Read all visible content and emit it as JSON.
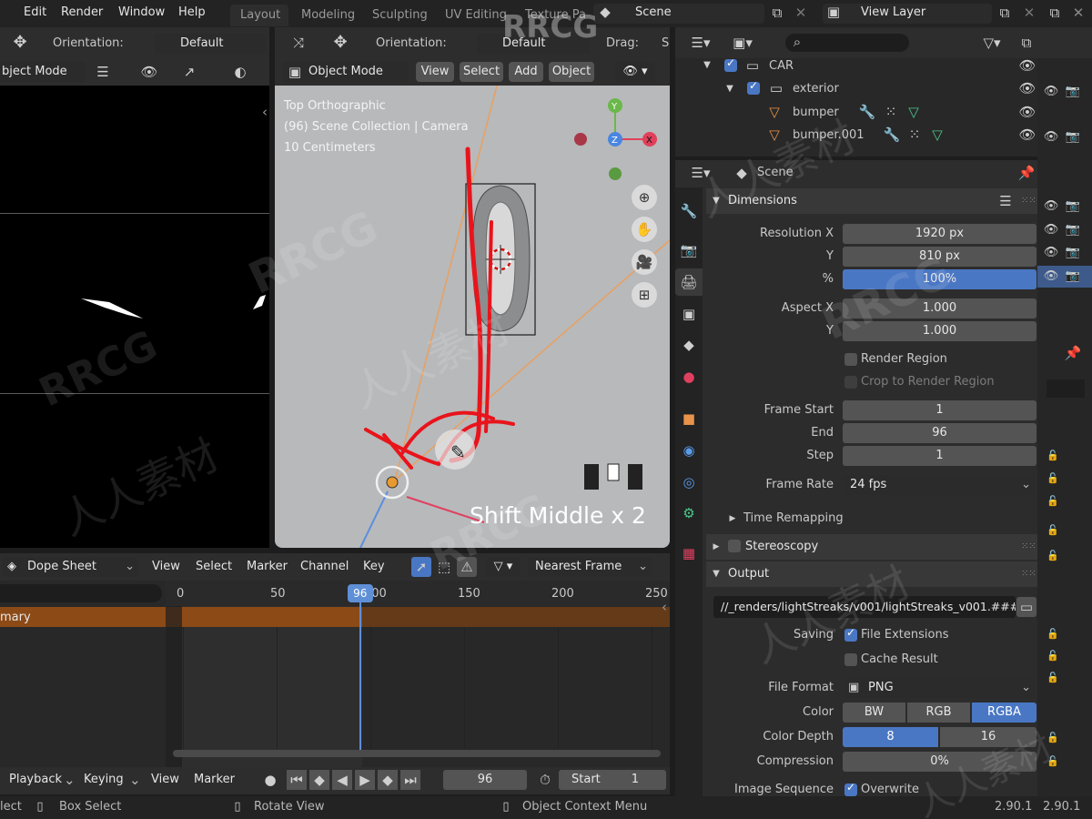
{
  "topbar": {
    "menus": [
      "Edit",
      "Render",
      "Window",
      "Help"
    ],
    "workspace_tabs": [
      "Layout",
      "Modeling",
      "Sculpting",
      "UV Editing",
      "Texture Pa"
    ],
    "scene_name": "Scene",
    "view_layer": "View Layer"
  },
  "left_viewport": {
    "orientation_label": "Orientation:",
    "orientation_value": "Default",
    "mode": "bject Mode"
  },
  "viewport": {
    "orientation_label": "Orientation:",
    "orientation_value": "Default",
    "drag_label": "Drag:",
    "drag_value": "S",
    "mode": "Object Mode",
    "menus": [
      "View",
      "Select",
      "Add",
      "Object"
    ],
    "overlay": [
      "Top Orthographic",
      "(96) Scene Collection | Camera",
      "10 Centimeters"
    ],
    "gizmo": {
      "x": "X",
      "y": "Y",
      "z": "Z"
    },
    "keystroke": "Shift Middle x 2"
  },
  "outliner": {
    "rows": [
      {
        "label": "CAR",
        "checked": true
      },
      {
        "label": "exterior",
        "checked": true
      },
      {
        "label": "bumper"
      },
      {
        "label": "bumper.001"
      }
    ]
  },
  "properties": {
    "context": "Scene",
    "dimensions": {
      "title": "Dimensions",
      "resolution_x_label": "Resolution X",
      "resolution_x": "1920 px",
      "resolution_y_label": "Y",
      "resolution_y": "810 px",
      "percent_label": "%",
      "percent": "100%",
      "percent_fill": 1.0,
      "aspect_x_label": "Aspect X",
      "aspect_x": "1.000",
      "aspect_y_label": "Y",
      "aspect_y": "1.000",
      "render_region": "Render Region",
      "crop_region": "Crop to Render Region",
      "frame_start_label": "Frame Start",
      "frame_start": "1",
      "frame_end_label": "End",
      "frame_end": "96",
      "frame_step_label": "Step",
      "frame_step": "1",
      "frame_rate_label": "Frame Rate",
      "frame_rate": "24 fps",
      "time_remapping": "Time Remapping"
    },
    "stereoscopy": "Stereoscopy",
    "output": {
      "title": "Output",
      "path": "//_renders/lightStreaks/v001/lightStreaks_v001.###...",
      "saving_label": "Saving",
      "file_extensions": "File Extensions",
      "cache_result": "Cache Result",
      "file_format_label": "File Format",
      "file_format": "PNG",
      "color_label": "Color",
      "color_options": [
        "BW",
        "RGB",
        "RGBA"
      ],
      "color_selected": "RGBA",
      "color_depth_label": "Color Depth",
      "color_depth_options": [
        "8",
        "16"
      ],
      "color_depth_selected": "8",
      "compression_label": "Compression",
      "compression": "0%",
      "image_sequence_label": "Image Sequence",
      "overwrite": "Overwrite"
    }
  },
  "dopesheet": {
    "editor": "Dope Sheet",
    "menus": [
      "View",
      "Select",
      "Marker",
      "Channel",
      "Key"
    ],
    "snap_mode": "Nearest Frame",
    "ruler": [
      0,
      50,
      100,
      150,
      200,
      250
    ],
    "current_frame": 96,
    "summary_label": "mary"
  },
  "timeline": {
    "menus": [
      "Playback",
      "Keying",
      "View",
      "Marker"
    ],
    "current_frame": "96",
    "start_label": "Start",
    "start_value": "1"
  },
  "statusbar": {
    "select": "lect",
    "box_select": "Box Select",
    "rotate_view": "Rotate View",
    "context_menu": "Object Context Menu",
    "version": "2.90.1",
    "version_right": "2.90.1"
  },
  "watermarks": [
    "RRCG",
    "人人素材"
  ],
  "colors": {
    "accent_blue": "#4a77c4",
    "playhead": "#5f8fd6",
    "summary_orange": "#8b4a16",
    "annotation_red": "#e8141c",
    "camera_lines": "#e0954a"
  }
}
